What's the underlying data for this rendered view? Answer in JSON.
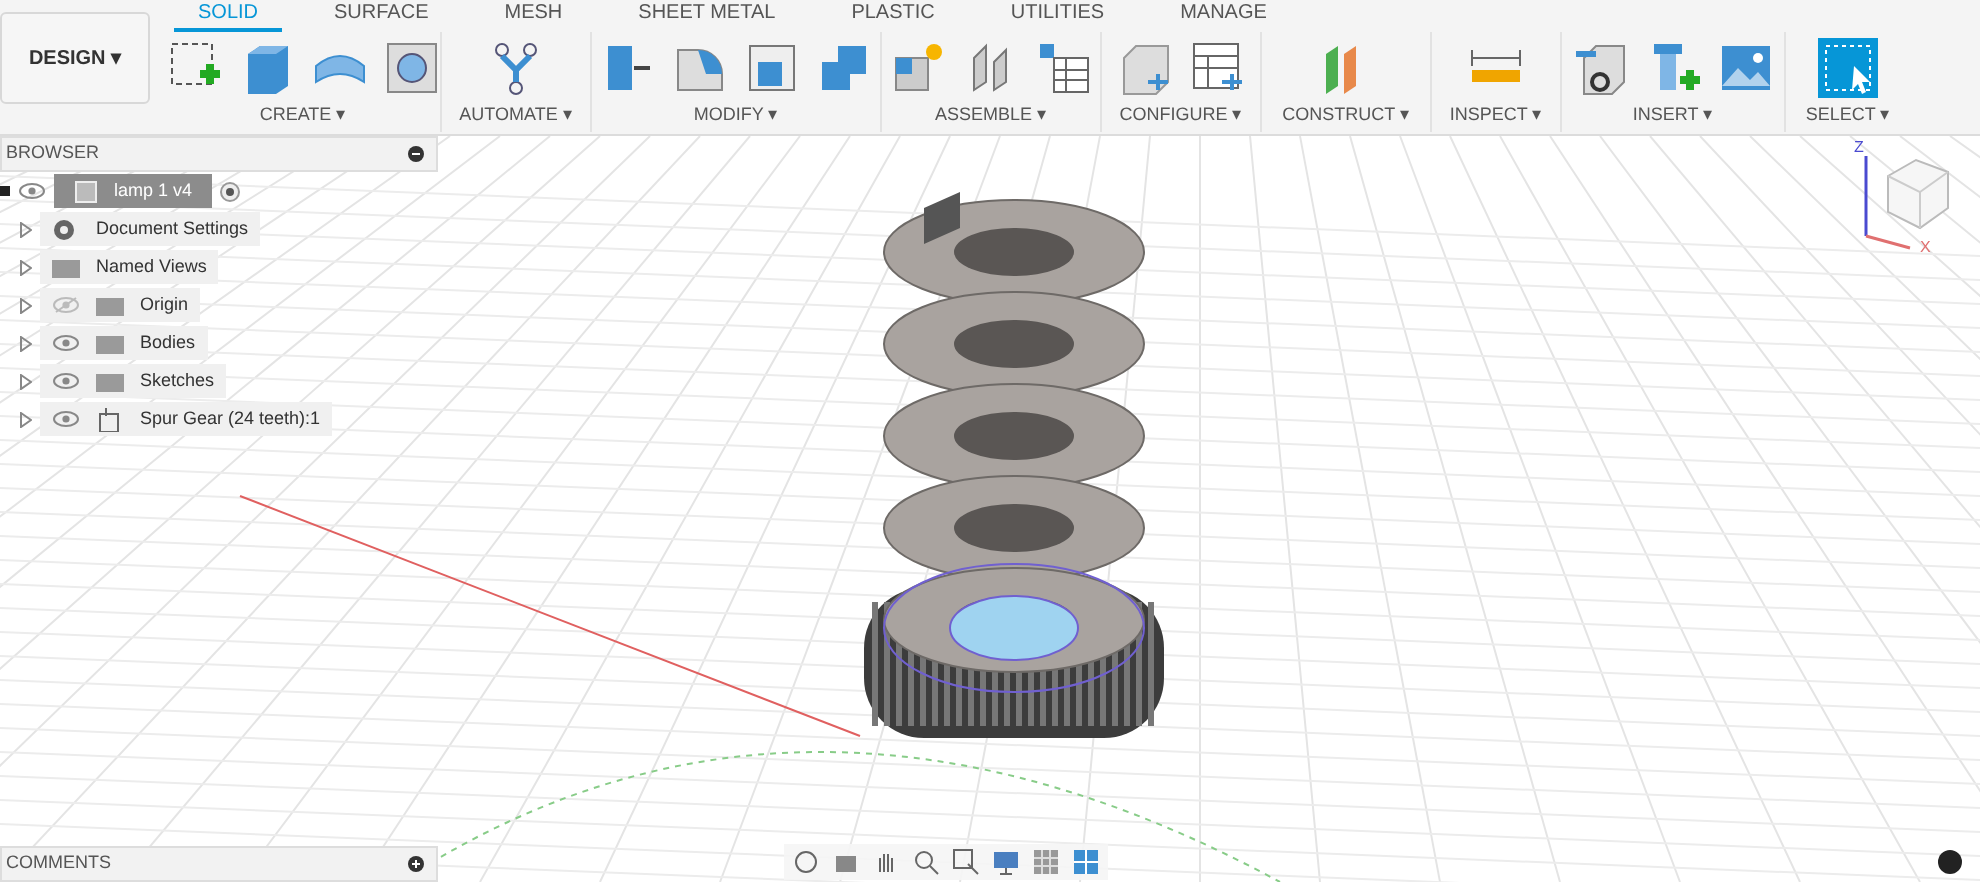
{
  "workspace_button": {
    "label": "DESIGN",
    "caret": "▾"
  },
  "tabs": [
    {
      "label": "SOLID",
      "selected": true
    },
    {
      "label": "SURFACE",
      "selected": false
    },
    {
      "label": "MESH",
      "selected": false
    },
    {
      "label": "SHEET METAL",
      "selected": false
    },
    {
      "label": "PLASTIC",
      "selected": false
    },
    {
      "label": "UTILITIES",
      "selected": false
    },
    {
      "label": "MANAGE",
      "selected": false
    }
  ],
  "tool_groups": [
    {
      "label": "CREATE ▾"
    },
    {
      "label": "AUTOMATE ▾"
    },
    {
      "label": "MODIFY ▾"
    },
    {
      "label": "ASSEMBLE ▾"
    },
    {
      "label": "CONFIGURE ▾"
    },
    {
      "label": "CONSTRUCT ▾"
    },
    {
      "label": "INSPECT ▾"
    },
    {
      "label": "INSERT ▾"
    },
    {
      "label": "SELECT ▾"
    }
  ],
  "browser": {
    "title": "BROWSER",
    "root": {
      "label": "lamp 1 v4",
      "visible": true,
      "selected": true,
      "children": [
        {
          "label": "Document Settings",
          "kind": "settings",
          "selected": false
        },
        {
          "label": "Named Views",
          "kind": "views",
          "selected": false
        },
        {
          "label": "Origin",
          "kind": "folder",
          "visible": false,
          "selected": false
        },
        {
          "label": "Bodies",
          "kind": "folder",
          "visible": true,
          "selected": false
        },
        {
          "label": "Sketches",
          "kind": "folder",
          "visible": true,
          "selected": false
        },
        {
          "label": "Spur Gear (24 teeth):1",
          "kind": "component",
          "visible": true,
          "selected": false
        }
      ]
    }
  },
  "view_cube": {
    "axes": [
      "Z",
      "X"
    ]
  },
  "comments": {
    "title": "COMMENTS"
  }
}
